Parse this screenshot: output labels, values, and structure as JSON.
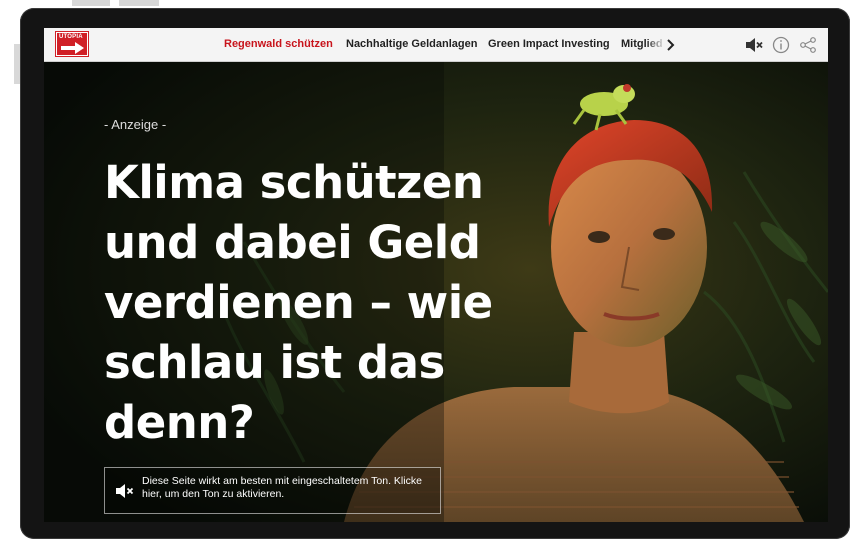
{
  "brand": {
    "logo_text": "UTOPIA",
    "accent": "#c8141c"
  },
  "nav": {
    "links": [
      {
        "label": "Regenwald schützen",
        "active": true
      },
      {
        "label": "Nachhaltige Geldanlagen",
        "active": false
      },
      {
        "label": "Green Impact Investing",
        "active": false
      },
      {
        "label": "Mitglied",
        "active": false
      }
    ],
    "next_icon": "chevron-right-icon"
  },
  "controls": {
    "mute_icon": "speaker-muted-icon",
    "info_icon": "info-icon",
    "share_icon": "share-icon"
  },
  "hero": {
    "ad_label": "- Anzeige -",
    "headline_lines": [
      "Klima schützen",
      "und dabei Geld",
      "verdienen – wie",
      "schlau ist das",
      "denn?"
    ]
  },
  "sound_notice": {
    "icon": "speaker-muted-icon",
    "text": "Diese Seite wirkt am besten mit eingeschaltetem Ton. Klicke hier, um den Ton zu aktivieren."
  }
}
